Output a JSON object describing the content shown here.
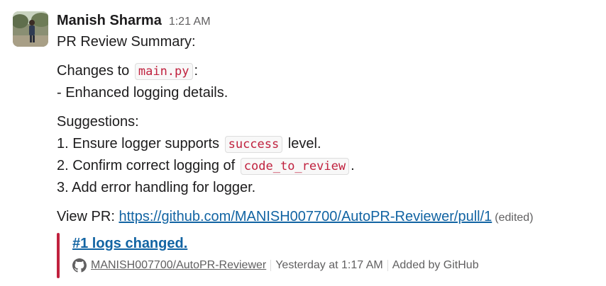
{
  "message": {
    "sender": "Manish Sharma",
    "time": "1:21 AM",
    "lines": {
      "title": "PR Review Summary:",
      "changes_prefix": "Changes to ",
      "changes_file": "main.py",
      "changes_suffix": ":",
      "change_item": "- Enhanced logging details.",
      "suggestions_heading": "Suggestions:",
      "s1_prefix": "1. Ensure logger supports ",
      "s1_code": "success",
      "s1_suffix": " level.",
      "s2_prefix": "2. Confirm correct logging of ",
      "s2_code": "code_to_review",
      "s2_suffix": ".",
      "s3": "3. Add error handling for logger.",
      "view_pr_label": "View PR: ",
      "pr_url": "https://github.com/MANISH007700/AutoPR-Reviewer/pull/1",
      "edited": "(edited)"
    },
    "unfurl": {
      "accent_color": "#c0213e",
      "title": "#1 logs changed.",
      "icon": "github-icon",
      "repo": "MANISH007700/AutoPR-Reviewer",
      "time": "Yesterday at 1:17 AM",
      "added_by": "Added by GitHub"
    }
  }
}
